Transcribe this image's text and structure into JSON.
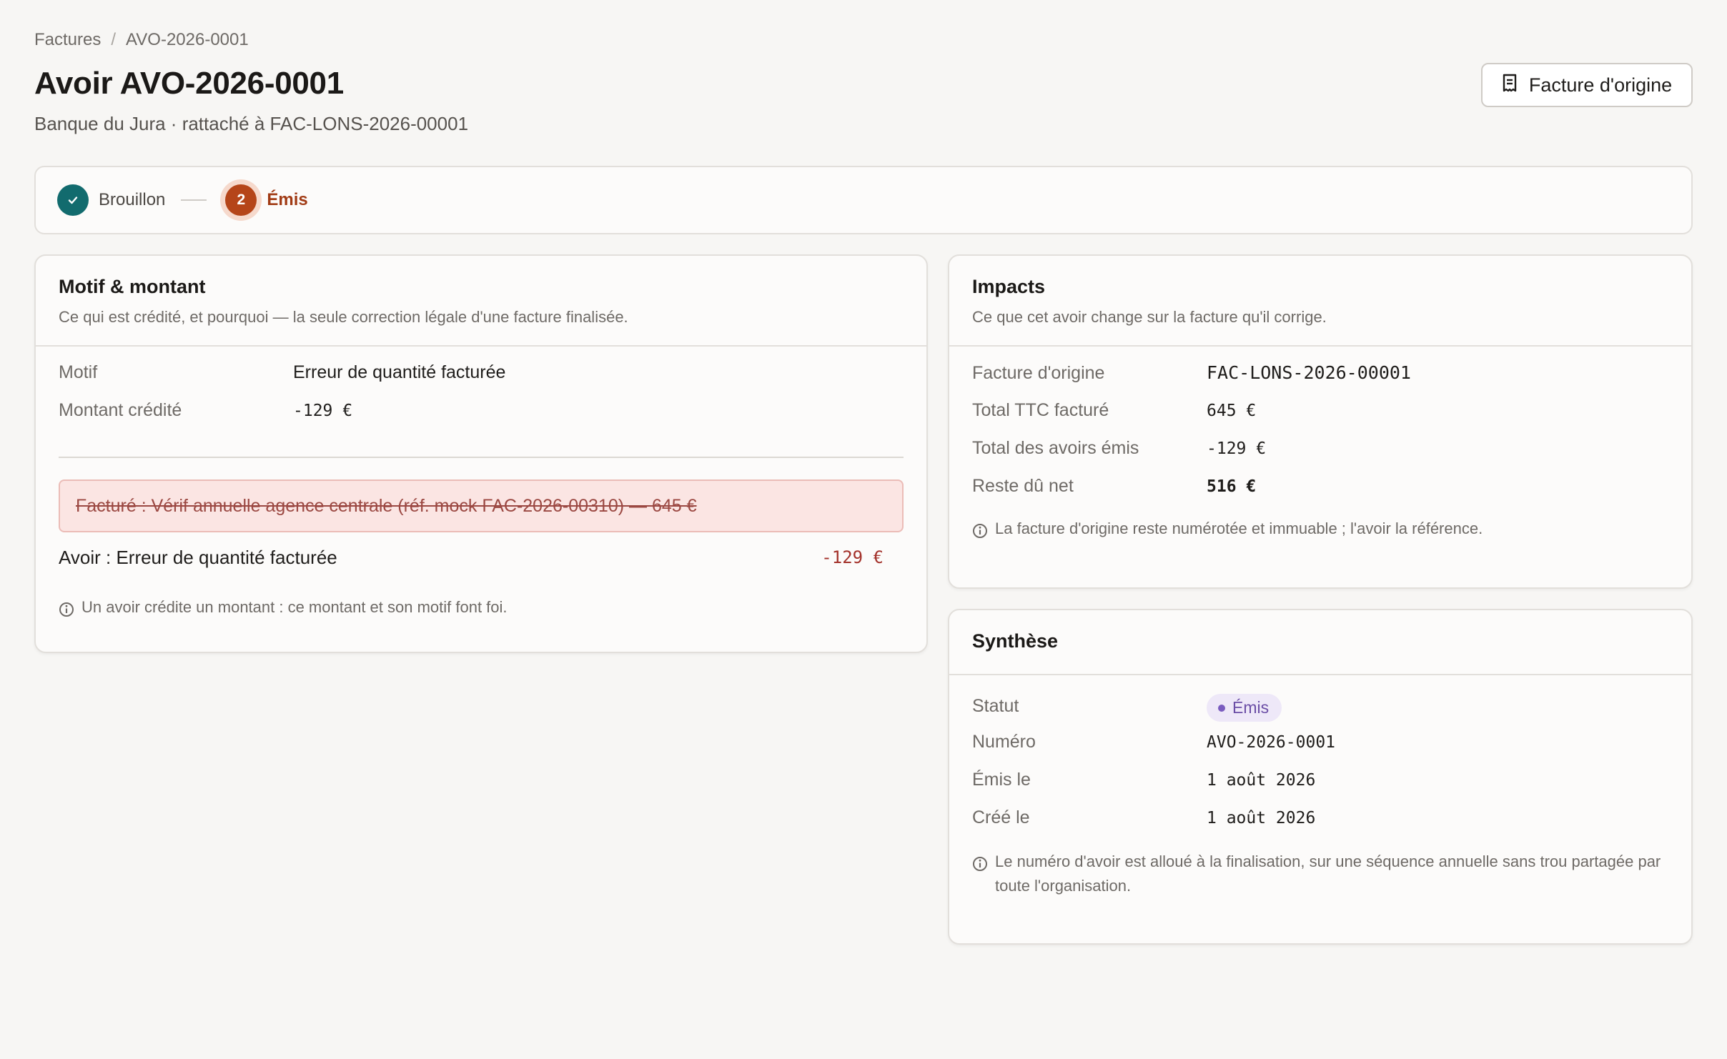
{
  "breadcrumb": {
    "parent": "Factures",
    "separator": "/",
    "current": "AVO-2026-0001"
  },
  "header": {
    "title": "Avoir AVO-2026-0001",
    "subtitle": "Banque du Jura · rattaché à FAC-LONS-2026-00001",
    "origin_button_label": "Facture d'origine",
    "origin_button_icon": "receipt-icon"
  },
  "stepper": {
    "steps": [
      {
        "label": "Brouillon",
        "state": "done",
        "icon": "check-icon"
      },
      {
        "number": "2",
        "label": "Émis",
        "state": "active"
      }
    ]
  },
  "motif_card": {
    "title": "Motif & montant",
    "description": "Ce qui est crédité, et pourquoi — la seule correction légale d'une facture finalisée.",
    "rows": [
      {
        "label": "Motif",
        "value": "Erreur de quantité facturée"
      },
      {
        "label": "Montant crédité",
        "value": "-129 €"
      }
    ],
    "struck_line": "Facturé : Vérif annuelle agence centrale (réf. mock FAC-2026-00310) — 645 €",
    "avoir_label": "Avoir : Erreur de quantité facturée",
    "avoir_amount": "-129 €",
    "note": "Un avoir crédite un montant : ce montant et son motif font foi."
  },
  "impacts_card": {
    "title": "Impacts",
    "description": "Ce que cet avoir change sur la facture qu'il corrige.",
    "rows": [
      {
        "label": "Facture d'origine",
        "value": "FAC-LONS-2026-00001"
      },
      {
        "label": "Total TTC facturé",
        "value": "645 €"
      },
      {
        "label": "Total des avoirs émis",
        "value": "-129 €"
      },
      {
        "label": "Reste dû net",
        "value": "516 €"
      }
    ],
    "note": "La facture d'origine reste numérotée et immuable ; l'avoir la référence."
  },
  "synthese_card": {
    "title": "Synthèse",
    "rows": [
      {
        "label": "Statut",
        "value": "Émis"
      },
      {
        "label": "Numéro",
        "value": "AVO-2026-0001"
      },
      {
        "label": "Émis le",
        "value": "1 août 2026"
      },
      {
        "label": "Créé le",
        "value": "1 août 2026"
      }
    ],
    "note": "Le numéro d'avoir est alloué à la finalisation, sur une séquence annuelle sans trou partagée par toute l'organisation."
  },
  "colors": {
    "accent": "#b54519",
    "done_step": "#126b6e",
    "badge_bg": "#eee8f8",
    "badge_text": "#6b4ea6",
    "negative": "#a3312a"
  }
}
